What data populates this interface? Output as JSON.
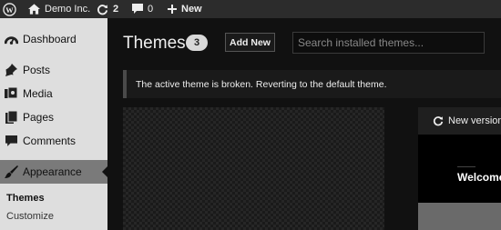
{
  "adminbar": {
    "site_name": "Demo Inc.",
    "updates_count": "2",
    "comments_count": "0",
    "new_label": "New"
  },
  "sidebar": {
    "items": [
      {
        "label": "Dashboard",
        "icon": "dashboard-icon"
      },
      {
        "label": "Posts",
        "icon": "pushpin-icon"
      },
      {
        "label": "Media",
        "icon": "media-icon"
      },
      {
        "label": "Pages",
        "icon": "pages-icon"
      },
      {
        "label": "Comments",
        "icon": "comment-icon"
      },
      {
        "label": "Appearance",
        "icon": "paintbrush-icon"
      }
    ],
    "submenu": [
      {
        "label": "Themes"
      },
      {
        "label": "Customize"
      }
    ]
  },
  "main": {
    "title": "Themes",
    "count": "3",
    "add_new_label": "Add New",
    "search_placeholder": "Search installed themes...",
    "notice": "The active theme is broken. Reverting to the default theme.",
    "update_text": "New version",
    "preview_heading": "Welcome"
  },
  "colors": {
    "adminbar_bg": "#2c2c2c",
    "sidebar_bg": "#dedede",
    "active_menu_bg": "#7a7a7a",
    "main_bg": "#111111"
  }
}
